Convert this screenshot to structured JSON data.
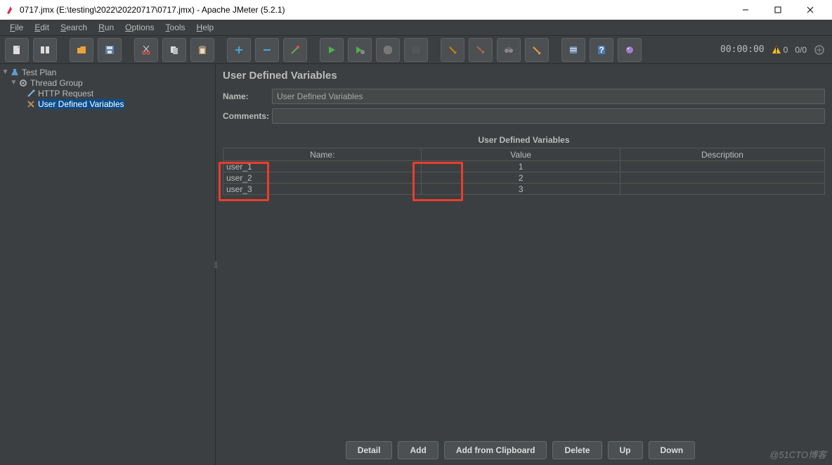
{
  "window": {
    "title": "0717.jmx (E:\\testing\\2022\\20220717\\0717.jmx) - Apache JMeter (5.2.1)"
  },
  "menu": {
    "file": "File",
    "edit": "Edit",
    "search": "Search",
    "run": "Run",
    "options": "Options",
    "tools": "Tools",
    "help": "Help"
  },
  "status": {
    "timer": "00:00:00",
    "warn": "0",
    "err": "0/0"
  },
  "tree": {
    "testplan": "Test Plan",
    "threadgroup": "Thread Group",
    "httprequest": "HTTP Request",
    "udv": "User Defined Variables"
  },
  "panel": {
    "title": "User Defined Variables",
    "name_label": "Name:",
    "name_value": "User Defined Variables",
    "comments_label": "Comments:",
    "comments_value": "",
    "table_title": "User Defined Variables",
    "headers": {
      "name": "Name:",
      "value": "Value",
      "description": "Description"
    },
    "rows": [
      {
        "name": "user_1",
        "value": "1",
        "description": ""
      },
      {
        "name": "user_2",
        "value": "2",
        "description": ""
      },
      {
        "name": "user_3",
        "value": "3",
        "description": ""
      }
    ],
    "buttons": {
      "detail": "Detail",
      "add": "Add",
      "add_clip": "Add from Clipboard",
      "delete": "Delete",
      "up": "Up",
      "down": "Down"
    }
  },
  "watermark": "@51CTO博客"
}
